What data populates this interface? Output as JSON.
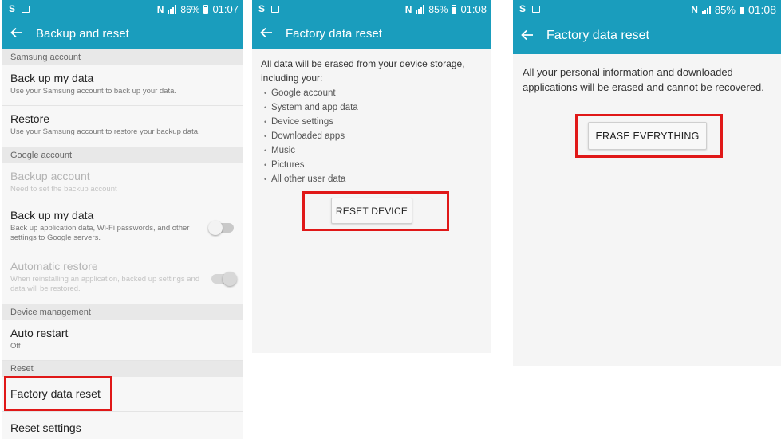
{
  "screen1": {
    "status": {
      "battery": "86%",
      "time": "01:07"
    },
    "title": "Backup and reset",
    "sections": {
      "samsung": "Samsung account",
      "google": "Google account",
      "device": "Device management",
      "reset": "Reset"
    },
    "items": {
      "backup_samsung": {
        "title": "Back up my data",
        "sub": "Use your Samsung account to back up your data."
      },
      "restore": {
        "title": "Restore",
        "sub": "Use your Samsung account to restore your backup data."
      },
      "backup_account": {
        "title": "Backup account",
        "sub": "Need to set the backup account"
      },
      "backup_google": {
        "title": "Back up my data",
        "sub": "Back up application data, Wi-Fi passwords, and other settings to Google servers."
      },
      "auto_restore": {
        "title": "Automatic restore",
        "sub": "When reinstalling an application, backed up settings and data will be restored."
      },
      "auto_restart": {
        "title": "Auto restart",
        "sub": "Off"
      },
      "factory_reset": {
        "title": "Factory data reset"
      },
      "reset_settings": {
        "title": "Reset settings"
      }
    }
  },
  "screen2": {
    "status": {
      "battery": "85%",
      "time": "01:08"
    },
    "title": "Factory data reset",
    "intro": "All data will be erased from your device storage, including your:",
    "bullets": [
      "Google account",
      "System and app data",
      "Device settings",
      "Downloaded apps",
      "Music",
      "Pictures",
      "All other user data"
    ],
    "button": "RESET DEVICE"
  },
  "screen3": {
    "status": {
      "battery": "85%",
      "time": "01:08"
    },
    "title": "Factory data reset",
    "message": "All your personal information and downloaded applications will be erased and cannot be recovered.",
    "button": "ERASE EVERYTHING"
  },
  "colors": {
    "appbar": "#1a9dbd",
    "highlight": "#e01818",
    "background": "#f5f5f5"
  },
  "icons": [
    "samsung-s-icon",
    "gallery-icon",
    "nfc-icon",
    "signal-icon",
    "battery-icon",
    "back-arrow-icon"
  ]
}
